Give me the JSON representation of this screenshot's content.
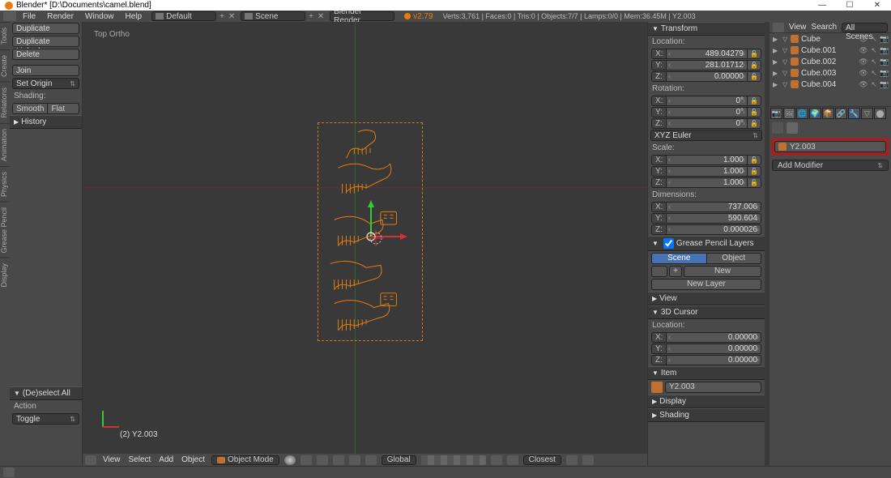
{
  "window": {
    "title": "Blender* [D:\\Documents\\camel.blend]",
    "min": "—",
    "max": "☐",
    "close": "✕"
  },
  "menubar": {
    "items": [
      "File",
      "Render",
      "Window",
      "Help"
    ],
    "layout": "Default",
    "scene": "Scene",
    "engine": "Blender Render",
    "version": "v2.79",
    "stats": "Verts:3,761 | Faces:0 | Tris:0 | Objects:7/7 | Lamps:0/0 | Mem:36.45M | Y2.003"
  },
  "toolshelf": {
    "tabs": [
      "Tools",
      "Create",
      "Relations",
      "Animation",
      "Physics",
      "Grease Pencil",
      "Display"
    ],
    "dup": "Duplicate",
    "dupl": "Duplicate Linked",
    "del": "Delete",
    "join": "Join",
    "setorigin": "Set Origin",
    "shading": "Shading:",
    "smooth": "Smooth",
    "flat": "Flat",
    "history": "History",
    "deselect": "(De)select All",
    "action": "Action",
    "toggle": "Toggle"
  },
  "viewport": {
    "label": "Top Ortho",
    "objlabel": "(2) Y2.003",
    "menus": [
      "View",
      "Select",
      "Add",
      "Object"
    ],
    "mode": "Object Mode",
    "orient": "Global",
    "snap": "Closest"
  },
  "npanel": {
    "transform": "Transform",
    "location": "Location:",
    "loc": {
      "x": "489.04279",
      "y": "281.01712",
      "z": "0.00000"
    },
    "rotation": "Rotation:",
    "rot": {
      "x": "0°",
      "y": "0°",
      "z": "0°"
    },
    "rotmode": "XYZ Euler",
    "scale": "Scale:",
    "sc": {
      "x": "1.000",
      "y": "1.000",
      "z": "1.000"
    },
    "dimensions": "Dimensions:",
    "dim": {
      "x": "737.006",
      "y": "590.604",
      "z": "0.000026"
    },
    "gp": "Grease Pencil Layers",
    "gp_scene": "Scene",
    "gp_object": "Object",
    "gp_new": "New",
    "gp_newlayer": "New Layer",
    "view": "View",
    "cursor3d": "3D Cursor",
    "cloc": "Location:",
    "cur": {
      "x": "0.00000",
      "y": "0.00000",
      "z": "0.00000"
    },
    "item": "Item",
    "itemname": "Y2.003",
    "display": "Display",
    "shading": "Shading"
  },
  "outliner": {
    "menus": [
      "View",
      "Search"
    ],
    "scope": "All Scenes",
    "items": [
      {
        "name": "Cube",
        "indent": 1
      },
      {
        "name": "Cube.001",
        "indent": 1
      },
      {
        "name": "Cube.002",
        "indent": 1
      },
      {
        "name": "Cube.003",
        "indent": 1
      },
      {
        "name": "Cube.004",
        "indent": 1
      }
    ]
  },
  "properties": {
    "objname": "Y2.003",
    "addmod": "Add Modifier"
  }
}
